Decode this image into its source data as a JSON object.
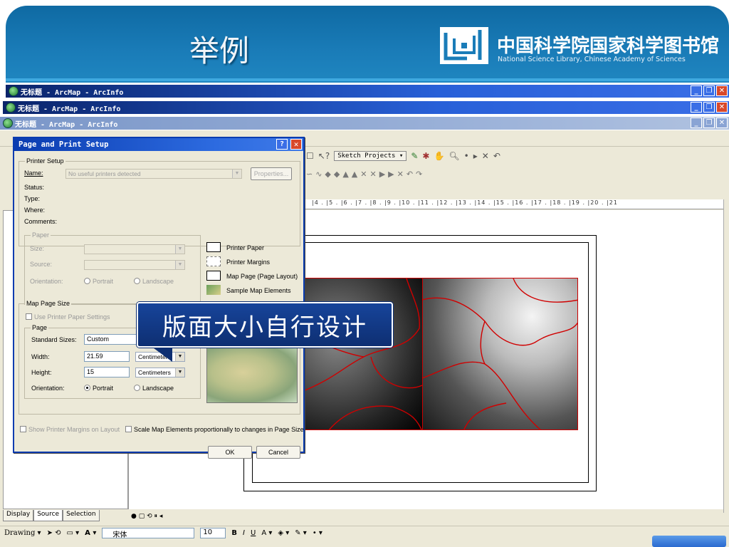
{
  "slide": {
    "title": "举例",
    "logo_cn": "中国科学院国家科学图书馆",
    "logo_en": "National Science Library, Chinese Academy of Sciences"
  },
  "windows": [
    {
      "title": "无标题 - ArcMap - ArcInfo"
    },
    {
      "title": "无标题 - ArcMap - ArcInfo"
    },
    {
      "title": "无标题 - ArcMap - ArcInfo"
    }
  ],
  "toolbar": {
    "sketch_projects": "Sketch Projects ▾"
  },
  "ruler": {
    "ticks": "|4 . |5 . |6 . |7 . |8 . |9 . |10 . |11 . |12 . |13 . |14 . |15 . |16 . |17 . |18 . |19 . |20 . |21"
  },
  "dialog": {
    "title": "Page and Print Setup",
    "printer_setup": {
      "legend": "Printer Setup",
      "name_label": "Name:",
      "name_value": "No useful printers detected",
      "properties_button": "Properties...",
      "status_label": "Status:",
      "type_label": "Type:",
      "where_label": "Where:",
      "comments_label": "Comments:"
    },
    "paper": {
      "legend": "Paper",
      "size_label": "Size:",
      "source_label": "Source:",
      "orientation_label": "Orientation:",
      "portrait": "Portrait",
      "landscape": "Landscape"
    },
    "legend_items": [
      {
        "label": "Printer Paper"
      },
      {
        "label": "Printer Margins"
      },
      {
        "label": "Map Page (Page Layout)"
      },
      {
        "label": "Sample Map Elements"
      }
    ],
    "map_page_size": {
      "legend": "Map Page Size",
      "use_printer_settings": "Use Printer Paper Settings",
      "page_legend": "Page",
      "standard_sizes_label": "Standard Sizes:",
      "standard_sizes_value": "Custom",
      "width_label": "Width:",
      "width_value": "21.59",
      "width_unit": "Centimeters",
      "height_label": "Height:",
      "height_value": "15",
      "height_unit": "Centimeters",
      "orientation_label": "Orientation:",
      "portrait": "Portrait",
      "landscape": "Landscape"
    },
    "show_margins": "Show Printer Margins on Layout",
    "scale_elements": "Scale Map Elements proportionally to changes in Page Size",
    "ok": "OK",
    "cancel": "Cancel"
  },
  "callout": {
    "text": "版面大小自行设计"
  },
  "toc_tabs": [
    {
      "label": "Display"
    },
    {
      "label": "Source"
    },
    {
      "label": "Selection"
    }
  ],
  "drawing": {
    "label": "Drawing ▾",
    "font": "宋体",
    "size": "10",
    "bold": "B",
    "italic": "I",
    "underline": "U"
  },
  "colors": {
    "header_blue": "#1a7cb8",
    "titlebar_blue": "#2860d8",
    "callout_bg": "#17449a",
    "map_border_red": "#cc0000"
  }
}
